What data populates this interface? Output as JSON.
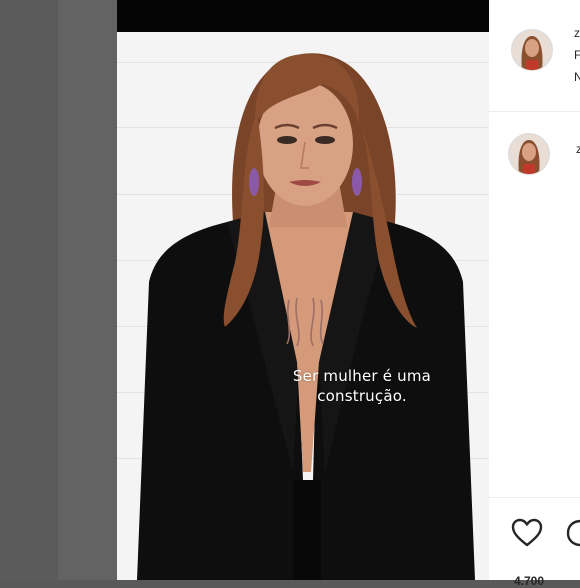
{
  "video": {
    "caption_line1": "Ser mulher é uma",
    "caption_line2": "construção."
  },
  "panel": {
    "post_author_initial": "z",
    "caption_line1": "F",
    "caption_line2": "N",
    "comment_author_initial": "z",
    "likes_partial": "4.700"
  },
  "icons": {
    "like": "heart-icon",
    "comment": "comment-icon"
  },
  "colors": {
    "page_background": "#595959",
    "panel_background": "#ffffff",
    "caption_text": "#ffffff",
    "blazer": "#0e0e0e",
    "hair": "#8a4f2f"
  }
}
